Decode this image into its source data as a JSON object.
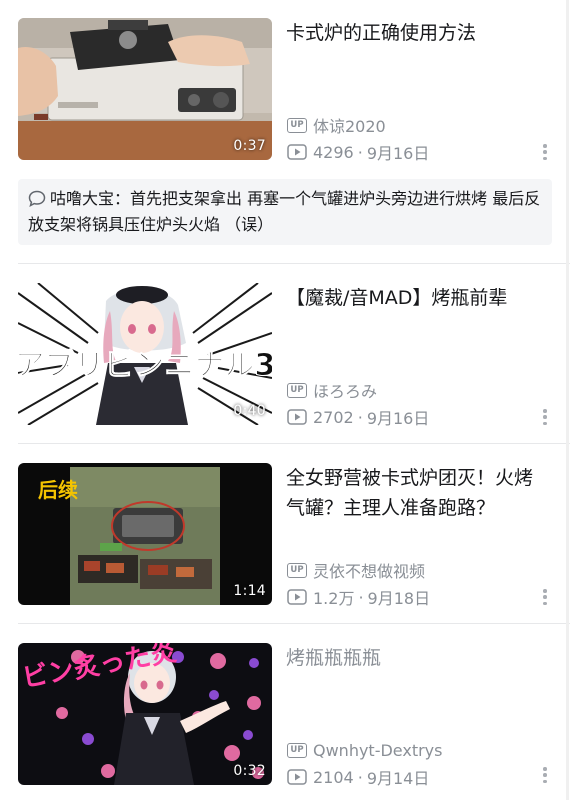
{
  "videos": [
    {
      "title": "卡式炉的正确使用方法",
      "up_badge": "UP",
      "uploader": "体谅2020",
      "views": "4296",
      "separator": "·",
      "date": "9月16日",
      "duration": "0:37",
      "comment": {
        "author": "咕噜大宝：",
        "text": "首先把支架拿出 再塞一个气罐进炉头旁边进行烘烤 最后反放支架将锅具压住炉头火焰 （误）"
      }
    },
    {
      "title": "【魔裁/音MAD】烤瓶前辈",
      "up_badge": "UP",
      "uploader": "ほろろみ",
      "views": "2702",
      "separator": "·",
      "date": "9月16日",
      "duration": "0:40",
      "thumb_text": "アブリビンニナル3"
    },
    {
      "title": "全女野营被卡式炉团灭！火烤气罐？主理人准备跑路？",
      "up_badge": "UP",
      "uploader": "灵依不想做视频",
      "views": "1.2万",
      "separator": "·",
      "date": "9月18日",
      "duration": "1:14",
      "thumb_text": "后续"
    },
    {
      "title": "烤瓶瓶瓶瓶",
      "up_badge": "UP",
      "uploader": "Qwnhyt-Dextrys",
      "views": "2104",
      "separator": "·",
      "date": "9月14日",
      "duration": "0:32",
      "thumb_text": "ビン炙った炎"
    }
  ],
  "colors": {
    "text": "#18191c",
    "meta": "#8a8f96",
    "comment_bg": "#f4f5f7",
    "divider": "#e7e8ea"
  },
  "icons": [
    "up-badge-icon",
    "play-count-icon",
    "more-options-icon",
    "comment-bubble-icon"
  ]
}
